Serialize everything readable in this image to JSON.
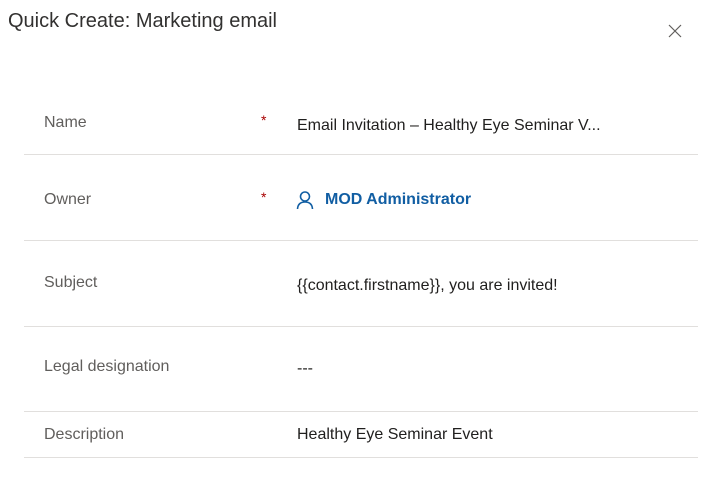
{
  "dialog": {
    "title": "Quick Create: Marketing email",
    "close_icon": "close-icon"
  },
  "fields": {
    "name": {
      "label": "Name",
      "required_marker": "*",
      "value": "Email Invitation – Healthy Eye Seminar V..."
    },
    "owner": {
      "label": "Owner",
      "required_marker": "*",
      "icon": "person-icon",
      "value": "MOD Administrator"
    },
    "subject": {
      "label": "Subject",
      "value": "{{contact.firstname}}, you are invited!"
    },
    "legal_designation": {
      "label": "Legal designation",
      "value": "---"
    },
    "description": {
      "label": "Description",
      "value": "Healthy Eye Seminar Event"
    }
  },
  "colors": {
    "required": "#a80000",
    "link": "#115ea3",
    "divider": "#e1dfdd",
    "label": "#605e5c"
  }
}
